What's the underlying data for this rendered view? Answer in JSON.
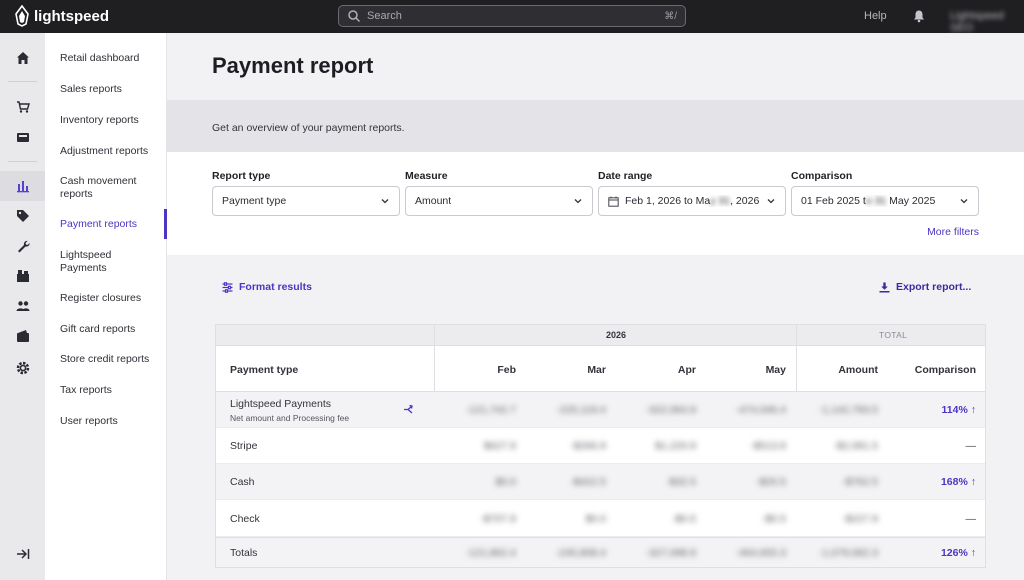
{
  "topbar": {
    "brand": "lightspeed",
    "search_placeholder": "Search",
    "search_shortcut": "⌘/",
    "help": "Help",
    "user_name": "Lightspeed SEO"
  },
  "rail": {
    "icons": [
      "home-icon",
      "cart-icon",
      "register-icon",
      "reports-icon",
      "tag-icon",
      "wrench-icon",
      "inventory-icon",
      "customers-icon",
      "wallet-icon",
      "settings-icon",
      "collapse-icon"
    ],
    "active": "reports-icon"
  },
  "subnav": {
    "items": [
      "Retail dashboard",
      "Sales reports",
      "Inventory reports",
      "Adjustment reports",
      "Cash movement reports",
      "Payment reports",
      "Lightspeed Payments",
      "Register closures",
      "Gift card reports",
      "Store credit reports",
      "Tax reports",
      "User reports"
    ],
    "active": "Payment reports"
  },
  "page": {
    "title": "Payment report",
    "overview": "Get an overview of your payment reports."
  },
  "filters": {
    "report_type": {
      "label": "Report type",
      "value": "Payment type"
    },
    "measure": {
      "label": "Measure",
      "value": "Amount"
    },
    "date_range": {
      "label": "Date range",
      "value_start": "Feb 1, 2026 to Ma",
      "value_hidden": "y 31",
      "value_end": ", 2026"
    },
    "comparison": {
      "label": "Comparison",
      "value_start": "01 Feb 2025 t",
      "value_hidden": "o 31",
      "value_end": " May 2025"
    },
    "more_filters": "More filters"
  },
  "actions": {
    "format_results": "Format results",
    "export_report": "Export report..."
  },
  "table": {
    "group_year": "2026",
    "group_total": "TOTAL",
    "columns": [
      "Payment type",
      "Feb",
      "Mar",
      "Apr",
      "May",
      "Amount",
      "Comparison"
    ],
    "rows": [
      {
        "label": "Lightspeed Payments",
        "sub": "Net amount and Processing fee",
        "values": [
          "-121,742.7",
          "-225,119.4",
          "-322,064.9",
          "-474,046.4",
          "-1,142,793.5"
        ],
        "comparison": "114%",
        "trend": "up"
      },
      {
        "label": "Stripe",
        "sub": "",
        "values": [
          "$627.9",
          "-$266.9",
          "$1,220.9",
          "-$513.9",
          "-$2,081.5"
        ],
        "comparison": "—",
        "trend": ""
      },
      {
        "label": "Cash",
        "sub": "",
        "values": [
          "$0.0",
          "-$422.5",
          "-$32.5",
          "-$20.5",
          "-$762.5"
        ],
        "comparison": "168%",
        "trend": "up"
      },
      {
        "label": "Check",
        "sub": "",
        "values": [
          "-$707.9",
          "$0.0",
          "-$0.5",
          "-$0.5",
          "-$227.9"
        ],
        "comparison": "—",
        "trend": ""
      },
      {
        "label": "Totals",
        "sub": "",
        "values": [
          "-121,862.4",
          "-245,808.4",
          "-327,098.9",
          "-464,655.3",
          "-1,079,582.3"
        ],
        "comparison": "126%",
        "trend": "up"
      }
    ]
  }
}
